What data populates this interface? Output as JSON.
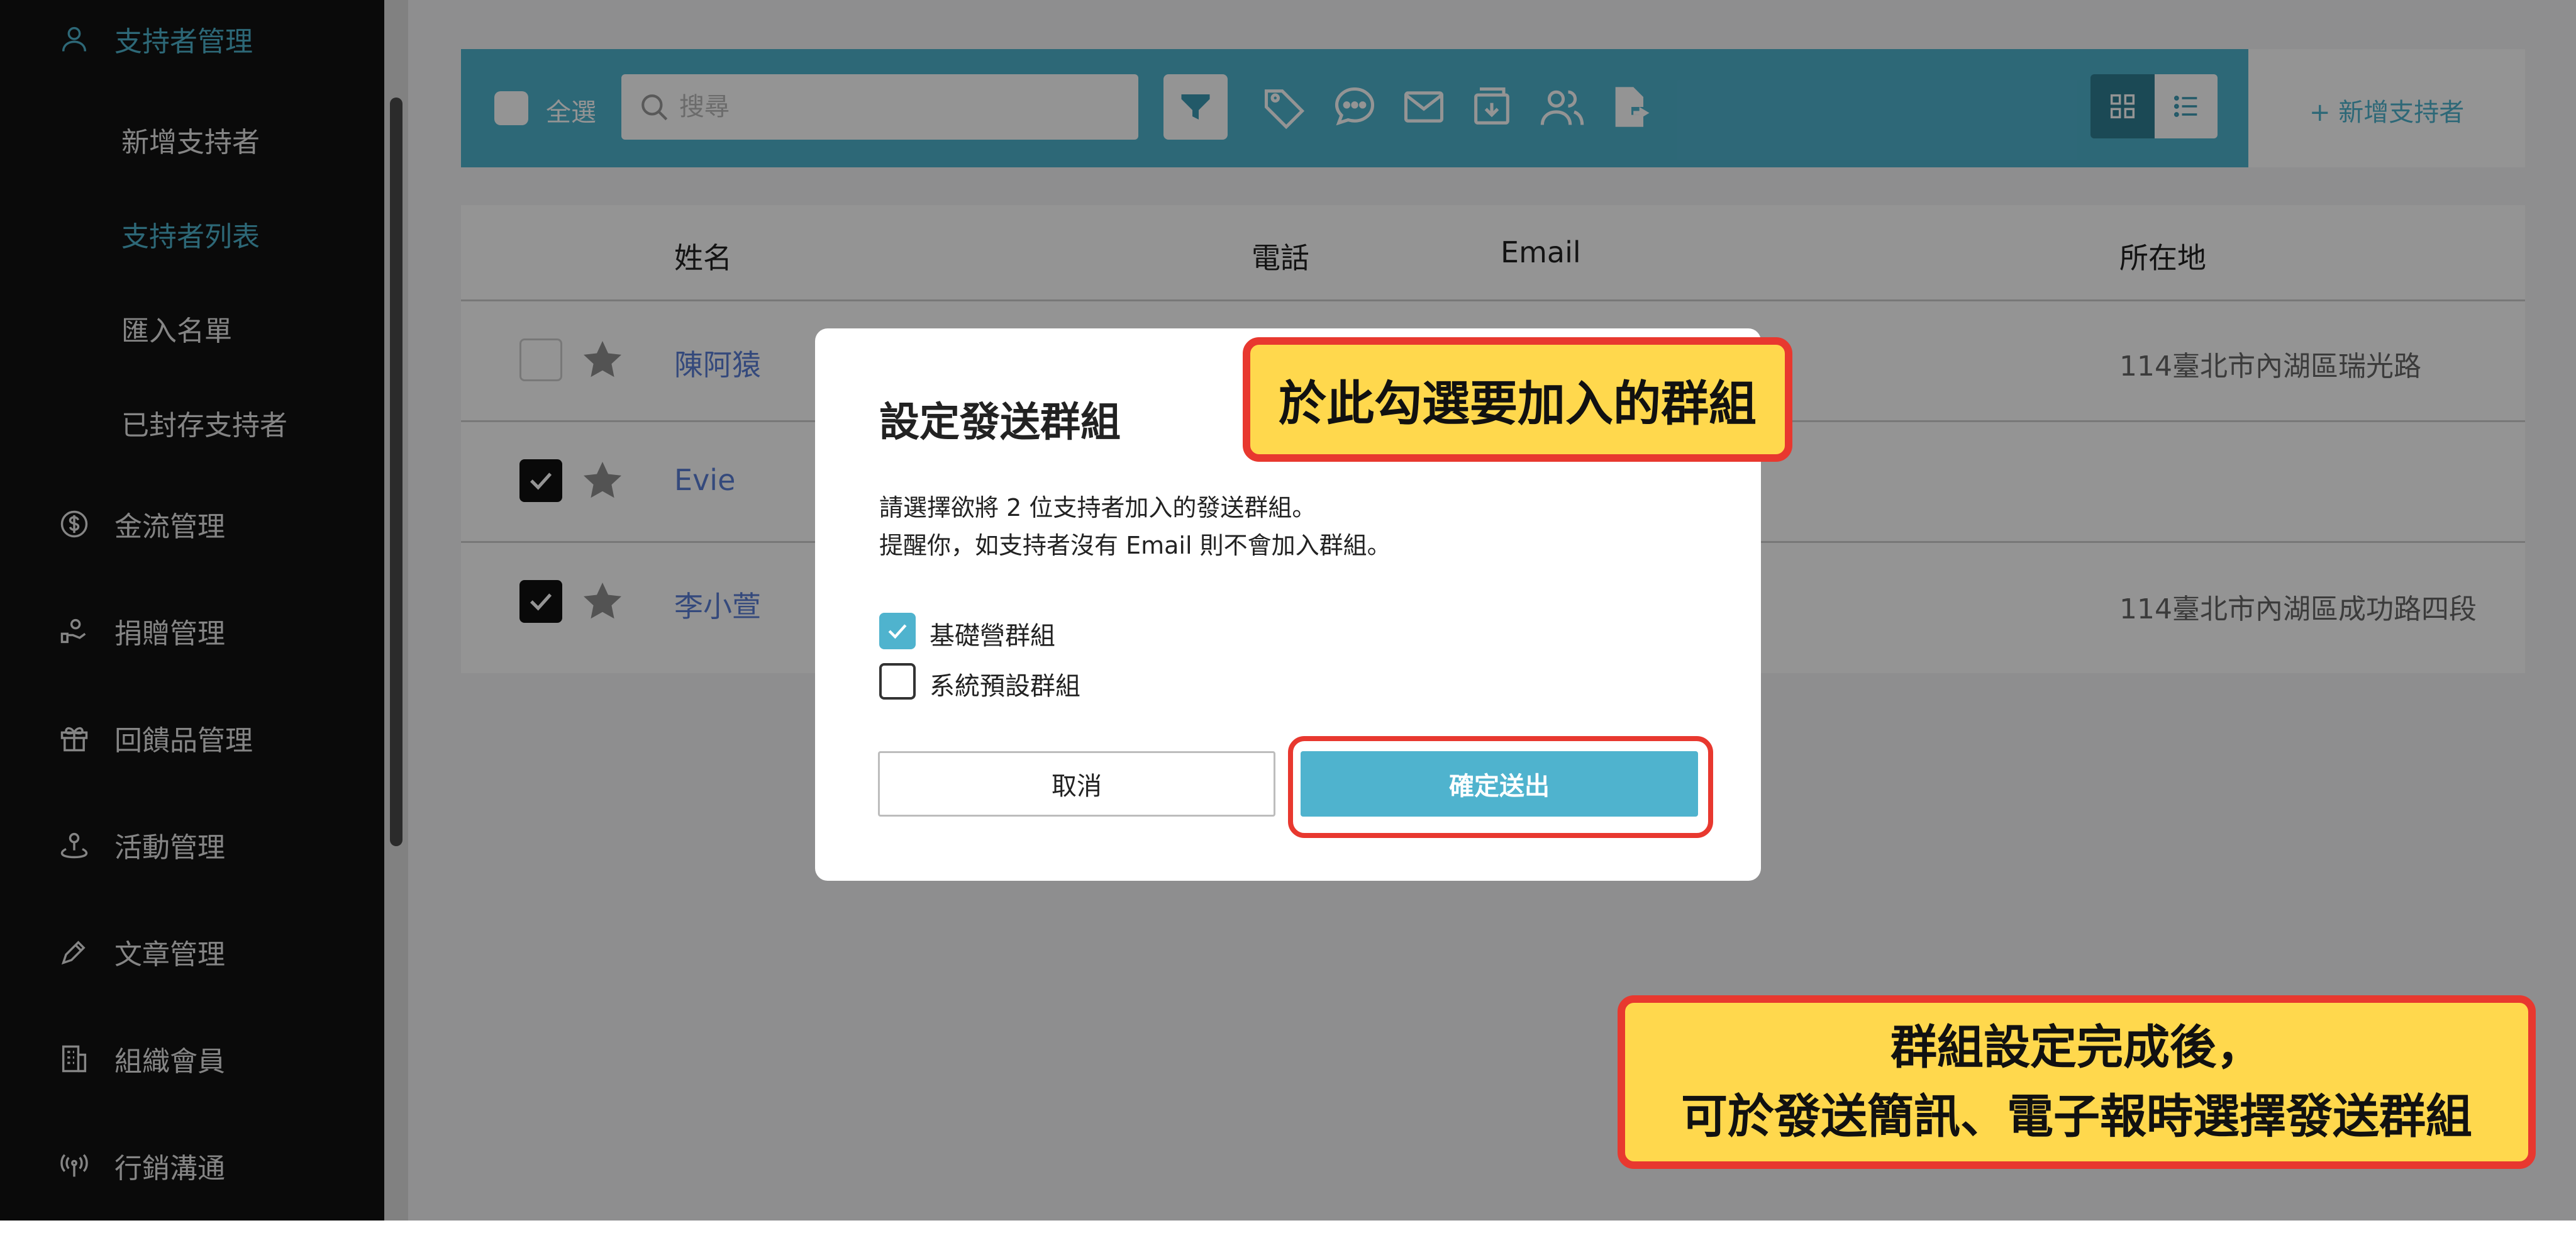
{
  "sidebar": {
    "items": [
      {
        "label": "支持者管理",
        "icon": "user-icon"
      },
      {
        "label": "金流管理",
        "icon": "dollar-icon"
      },
      {
        "label": "捐贈管理",
        "icon": "hand-donate-icon"
      },
      {
        "label": "回饋品管理",
        "icon": "gift-icon"
      },
      {
        "label": "活動管理",
        "icon": "person-pin-icon"
      },
      {
        "label": "文章管理",
        "icon": "pen-icon"
      },
      {
        "label": "組織會員",
        "icon": "building-icon"
      },
      {
        "label": "行銷溝通",
        "icon": "broadcast-icon"
      }
    ],
    "subitems": [
      "新增支持者",
      "支持者列表",
      "匯入名單",
      "已封存支持者"
    ]
  },
  "toolbar": {
    "select_all": "全選",
    "search_placeholder": "搜尋",
    "add_supporter": "+ 新增支持者"
  },
  "table": {
    "headers": {
      "name": "姓名",
      "phone": "電話",
      "email": "Email",
      "location": "所在地"
    },
    "rows": [
      {
        "name": "陳阿猿",
        "location": "114臺北市內湖區瑞光路",
        "checked": false
      },
      {
        "name": "Evie",
        "location": "",
        "checked": true
      },
      {
        "name": "李小萱",
        "location": "114臺北市內湖區成功路四段",
        "checked": true
      }
    ]
  },
  "modal": {
    "title": "設定發送群組",
    "desc_line1": "請選擇欲將 2 位支持者加入的發送群組。",
    "desc_line2": "提醒你，如支持者沒有 Email 則不會加入群組。",
    "options": [
      {
        "label": "基礎營群組",
        "checked": true
      },
      {
        "label": "系統預設群組",
        "checked": false
      }
    ],
    "cancel_label": "取消",
    "confirm_label": "確定送出"
  },
  "callouts": {
    "top": "於此勾選要加入的群組",
    "bottom_line1": "群組設定完成後，",
    "bottom_line2": "可於發送簡訊、電子報時選擇發送群組"
  },
  "colors": {
    "accent": "#4fb3ce",
    "sidebar_bg": "#121212",
    "callout_fill": "#ffd84d",
    "callout_border": "#e8382f",
    "link": "#5b7fd6"
  }
}
